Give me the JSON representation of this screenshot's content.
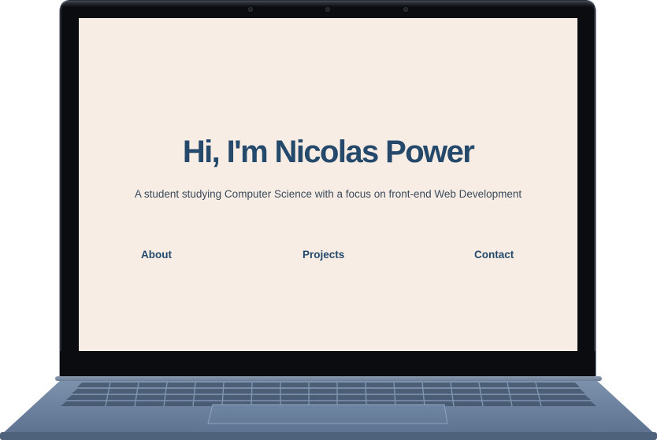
{
  "hero": {
    "title": "Hi, I'm Nicolas Power",
    "subtitle": "A student studying Computer Science with a focus on front-end Web Development"
  },
  "nav": {
    "about": "About",
    "projects": "Projects",
    "contact": "Contact"
  },
  "colors": {
    "screen_background": "#f7ede5",
    "accent": "#24496b",
    "text": "#3a4a5a",
    "laptop_body": "#6f86a3",
    "bezel": "#0b0c10"
  }
}
